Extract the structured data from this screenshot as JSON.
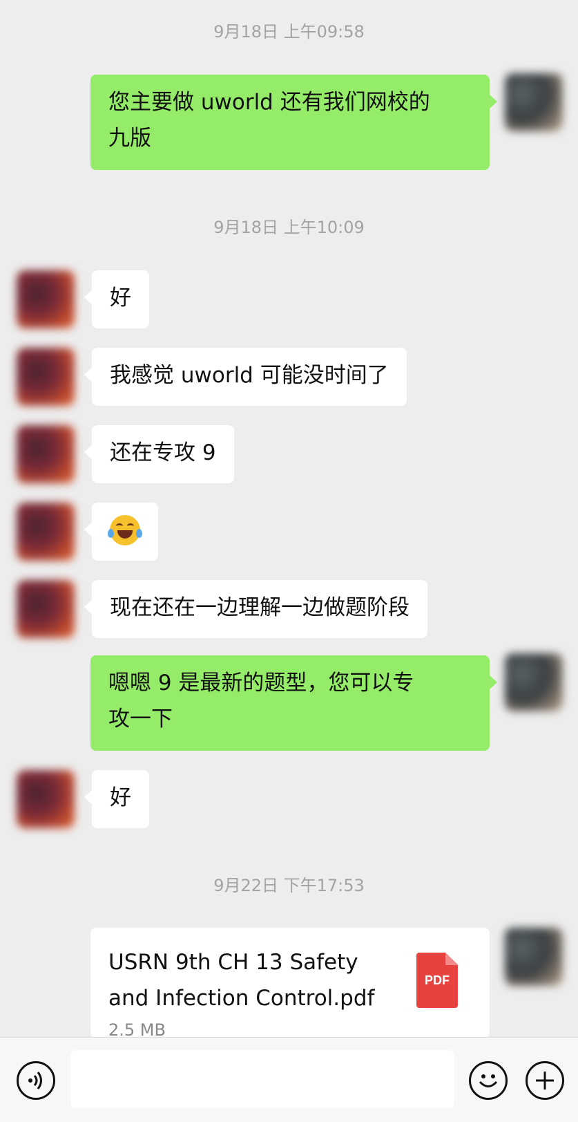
{
  "timestamps": {
    "t1": "9月18日 上午09:58",
    "t2": "9月18日 上午10:09",
    "t3": "9月22日 下午17:53"
  },
  "messages": {
    "m1_line1": "您主要做 uworld 还有我们网校的",
    "m1_line2": "九版",
    "m2": "好",
    "m3": "我感觉 uworld 可能没时间了",
    "m4": "还在专攻 9",
    "m5_emoji": "laughing-crying-emoji",
    "m6": "现在还在一边理解一边做题阶段",
    "m7_line1": "嗯嗯  9 是最新的题型，您可以专",
    "m7_line2": "攻一下",
    "m8": "好"
  },
  "file": {
    "name_line1": "USRN 9th CH 13 Safety",
    "name_line2": "and Infection Control.pdf",
    "size": "2.5 MB",
    "type_label": "PDF",
    "icon_color": "#e64340"
  },
  "colors": {
    "background": "#ededed",
    "outgoing_bubble": "#95ec69",
    "incoming_bubble": "#ffffff"
  },
  "input_bar": {
    "voice_icon": "voice-icon",
    "emoji_icon": "emoji-icon",
    "plus_icon": "plus-icon"
  }
}
